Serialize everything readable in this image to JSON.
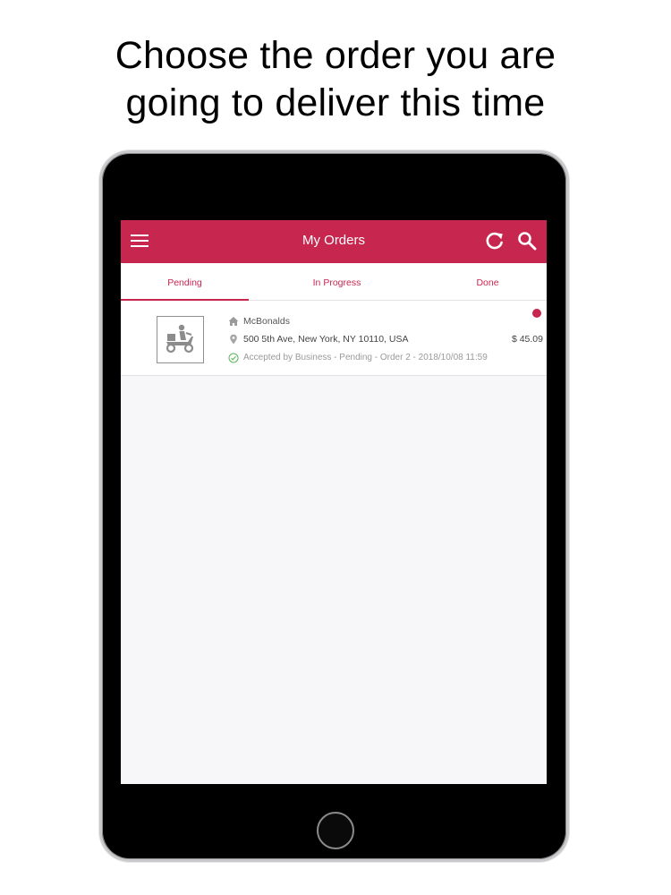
{
  "headline": {
    "line1": "Choose the order you are",
    "line2": "going to deliver this time"
  },
  "app": {
    "title": "My Orders",
    "icons": {
      "menu": "menu-icon",
      "refresh": "refresh-icon",
      "search": "search-icon"
    },
    "accent_color": "#c7264f"
  },
  "tabs": [
    {
      "label": "Pending",
      "selected": true
    },
    {
      "label": "In Progress",
      "selected": false
    },
    {
      "label": "Done",
      "selected": false
    }
  ],
  "orders": [
    {
      "business": "McBonalds",
      "address": "500 5th Ave, New York, NY 10110, USA",
      "status": "Accepted by Business - Pending - Order 2 - 2018/10/08 11:59",
      "price": "$ 45.09",
      "thumbnail_icon": "delivery-scooter-icon"
    }
  ]
}
